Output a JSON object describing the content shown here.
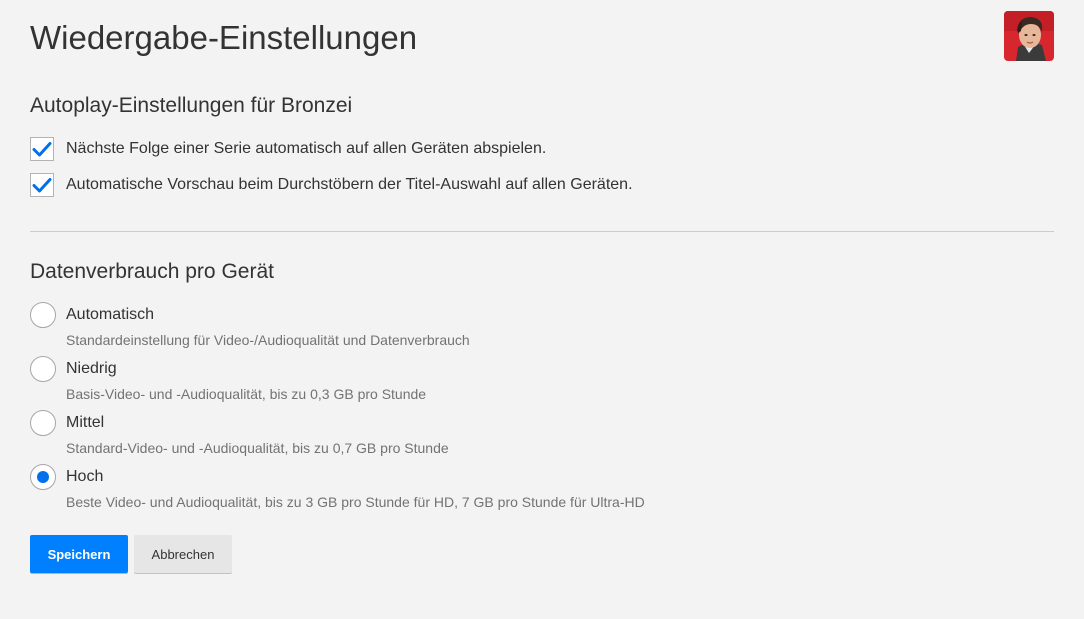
{
  "page": {
    "title": "Wiedergabe-Einstellungen"
  },
  "profile": {
    "avatar_icon": "profile-avatar-icon"
  },
  "autoplay": {
    "heading": "Autoplay-Einstellungen für Bronzei",
    "options": [
      {
        "label": "Nächste Folge einer Serie automatisch auf allen Geräten abspielen.",
        "checked": true
      },
      {
        "label": "Automatische Vorschau beim Durchstöbern der Titel-Auswahl auf allen Geräten.",
        "checked": true
      }
    ]
  },
  "data_usage": {
    "heading": "Datenverbrauch pro Gerät",
    "selected": "Hoch",
    "options": [
      {
        "label": "Automatisch",
        "description": "Standardeinstellung für Video-/Audioqualität und Datenverbrauch",
        "checked": false
      },
      {
        "label": "Niedrig",
        "description": "Basis-Video- und -Audioqualität, bis zu 0,3 GB pro Stunde",
        "checked": false
      },
      {
        "label": "Mittel",
        "description": "Standard-Video- und -Audioqualität, bis zu 0,7 GB pro Stunde",
        "checked": false
      },
      {
        "label": "Hoch",
        "description": "Beste Video- und Audioqualität, bis zu 3 GB pro Stunde für HD, 7 GB pro Stunde für Ultra-HD",
        "checked": true
      }
    ]
  },
  "actions": {
    "save_label": "Speichern",
    "cancel_label": "Abbrechen"
  },
  "colors": {
    "accent": "#0080ff",
    "radio_selected": "#0071eb",
    "checkmark": "#0071eb",
    "background": "#f3f3f3"
  }
}
